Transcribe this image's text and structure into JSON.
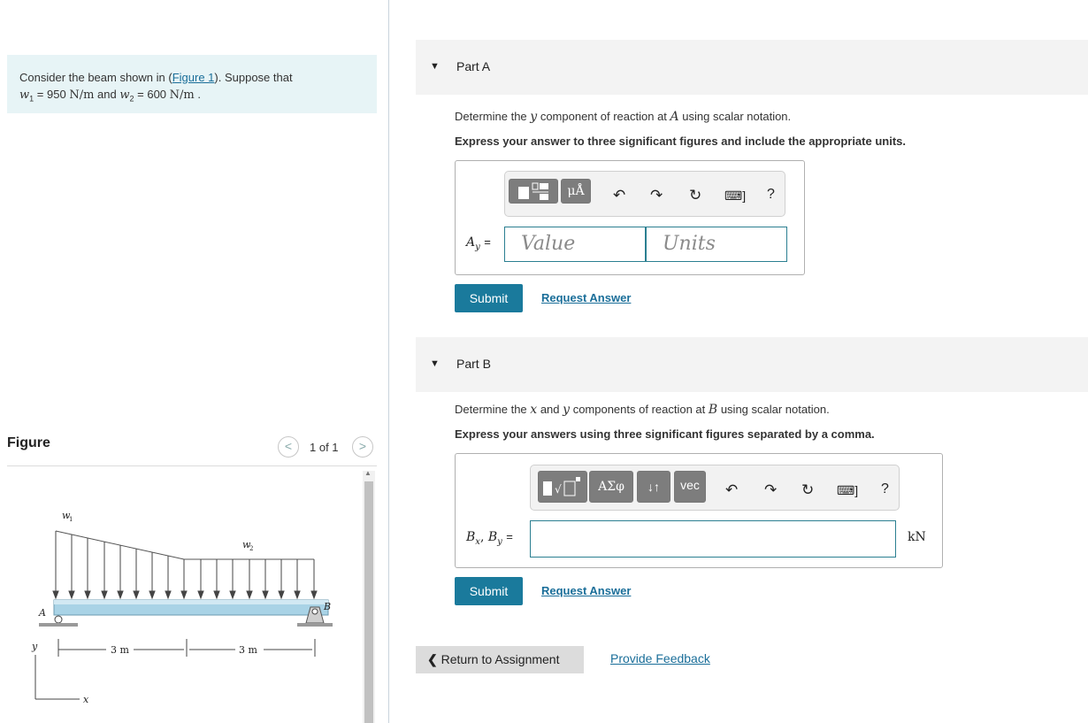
{
  "problem": {
    "intro": "Consider the beam shown in (",
    "figure_link": "Figure 1",
    "intro_end": "). Suppose that",
    "w1_var": "w",
    "w1_sub": "1",
    "w1_value": "= 950",
    "w1_unit": "N/m",
    "and": "and",
    "w2_var": "w",
    "w2_sub": "2",
    "w2_value": "= 600",
    "w2_unit": "N/m",
    "period": "."
  },
  "figure": {
    "title": "Figure",
    "page": "1 of 1",
    "prev": "<",
    "next": ">",
    "labels": {
      "w1": "w",
      "w1_sub": "1",
      "w2": "w",
      "w2_sub": "2",
      "A": "A",
      "B": "B",
      "dim1": "3 m",
      "dim2": "3 m",
      "y": "y",
      "x": "x"
    }
  },
  "partA": {
    "label": "Part A",
    "question_pre": "Determine the",
    "question_var1": "y",
    "question_mid": "component of reaction at",
    "question_var2": "A",
    "question_post": "using scalar notation.",
    "instruction": "Express your answer to three significant figures and include the appropriate units.",
    "eq_label": "A",
    "eq_sub": "y",
    "eq_equals": "=",
    "value_placeholder": "Value",
    "units_placeholder": "Units",
    "toolbar_btn2": "μÅ",
    "help": "?",
    "submit": "Submit",
    "request": "Request Answer"
  },
  "partB": {
    "label": "Part B",
    "question_pre": "Determine the",
    "question_var1": "x",
    "question_and": "and",
    "question_var2": "y",
    "question_mid": "components of reaction at",
    "question_var3": "B",
    "question_post": "using scalar notation.",
    "instruction": "Express your answers using three significant figures separated by a comma.",
    "eq_label": "B",
    "eq_sub_x": "x",
    "eq_comma": ",",
    "eq_label2": "B",
    "eq_sub_y": "y",
    "eq_equals": "=",
    "unit": "kN",
    "toolbar_btn2": "ΑΣφ",
    "toolbar_btn3": "↓↑",
    "toolbar_btn4": "vec",
    "help": "?",
    "submit": "Submit",
    "request": "Request Answer"
  },
  "footer": {
    "return": "Return to Assignment",
    "feedback": "Provide Feedback"
  }
}
